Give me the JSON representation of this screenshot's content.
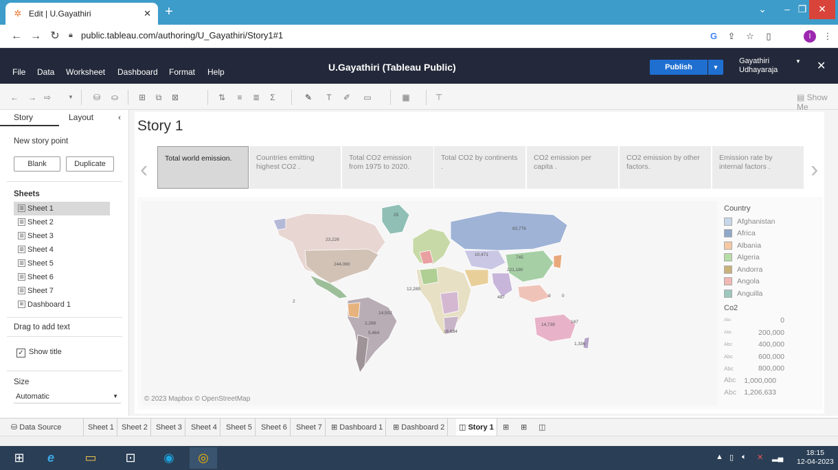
{
  "browser": {
    "tab_title": "Edit | U.Gayathiri",
    "new_tab": "+",
    "url": "public.tableau.com/authoring/U_Gayathiri/Story1#1",
    "profile_initial": "I"
  },
  "header": {
    "menu": [
      "File",
      "Data",
      "Worksheet",
      "Dashboard",
      "Format",
      "Help"
    ],
    "title": "U.Gayathiri (Tableau Public)",
    "publish_label": "Publish",
    "user_first": "Gayathiri",
    "user_last": "Udhayaraja"
  },
  "toolbar": {
    "show_me": "Show Me"
  },
  "left_pane": {
    "tab_story": "Story",
    "tab_layout": "Layout",
    "new_story_point": "New story point",
    "blank_label": "Blank",
    "duplicate_label": "Duplicate",
    "sheets_title": "Sheets",
    "sheets": [
      "Sheet 1",
      "Sheet 2",
      "Sheet 3",
      "Sheet 4",
      "Sheet 5",
      "Sheet 6",
      "Sheet 7",
      "Dashboard 1"
    ],
    "drag_text": "Drag to add text",
    "show_title": "Show title",
    "size_title": "Size",
    "size_value": "Automatic"
  },
  "story": {
    "title": "Story 1",
    "points": [
      "Total world emission.",
      "Countries emitting highest CO2 .",
      "Total CO2 emission from 1975 to 2020.",
      "Total CO2 by continents .",
      "CO2 emission per capita .",
      "CO2 emission by other factors.",
      "Emission rate by internal factors ."
    ]
  },
  "map": {
    "attribution": "© 2023 Mapbox © OpenStreetMap",
    "labels": [
      "25",
      "23,226",
      "83,776",
      "244,060",
      "10,471",
      "221,180",
      "745",
      "14,502",
      "14,739",
      "2,288",
      "5,464",
      "16,634",
      "1,336",
      "487",
      "12,289",
      "9",
      "0",
      "2",
      "187"
    ]
  },
  "legend": {
    "country_title": "Country",
    "countries": [
      {
        "name": "Afghanistan",
        "color": "#c6d7e8"
      },
      {
        "name": "Africa",
        "color": "#8fa8c8"
      },
      {
        "name": "Albania",
        "color": "#f5c9a3"
      },
      {
        "name": "Algeria",
        "color": "#b8dca6"
      },
      {
        "name": "Andorra",
        "color": "#c9b27a"
      },
      {
        "name": "Angola",
        "color": "#f1b8b3"
      },
      {
        "name": "Anguilla",
        "color": "#9fc6bd"
      }
    ],
    "co2_title": "Co2",
    "abc": "Abc",
    "sizes": [
      "0",
      "200,000",
      "400,000",
      "600,000",
      "800,000",
      "1,000,000",
      "1,206,633"
    ]
  },
  "bottom_tabs": {
    "data_source": "Data Source",
    "tabs": [
      "Sheet 1",
      "Sheet 2",
      "Sheet 3",
      "Sheet 4",
      "Sheet 5",
      "Sheet 6",
      "Sheet 7",
      "Dashboard 1",
      "Dashboard 2",
      "Story 1"
    ]
  },
  "taskbar": {
    "time": "18:15",
    "date": "12-04-2023"
  }
}
